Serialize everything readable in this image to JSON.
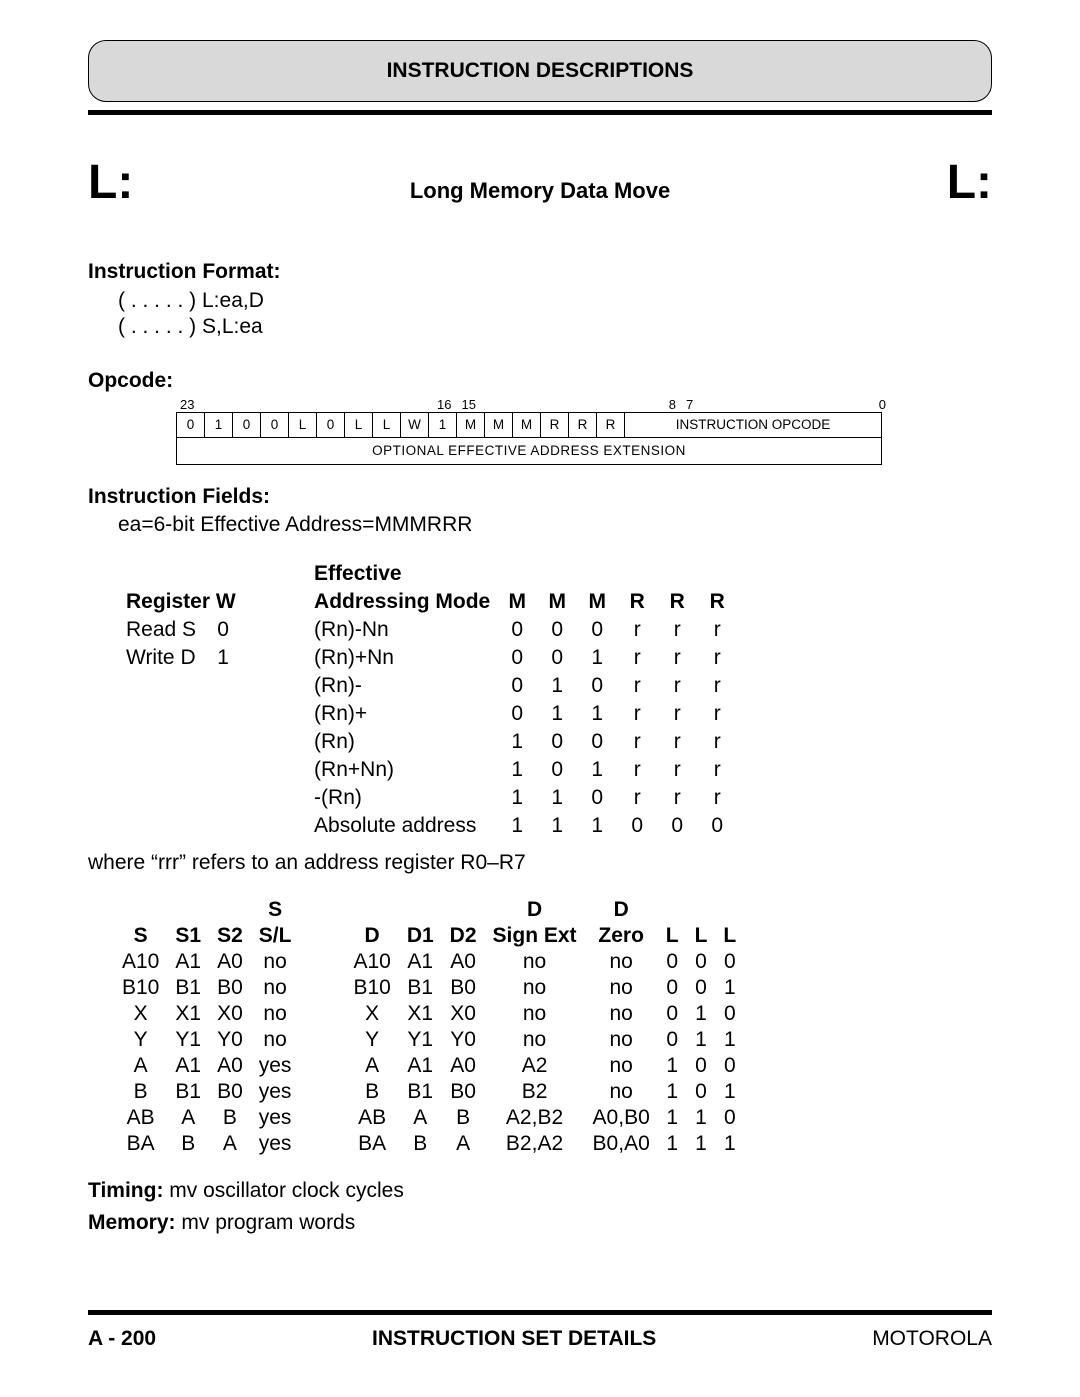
{
  "header": {
    "title": "INSTRUCTION DESCRIPTIONS"
  },
  "title": {
    "mnemonic_left": "L:",
    "name": "Long Memory Data Move",
    "mnemonic_right": "L:"
  },
  "format": {
    "heading": "Instruction Format:",
    "line1": "( . . . . . ) L:ea,D",
    "line2": "( . . . . . ) S,L:ea"
  },
  "opcode": {
    "heading": "Opcode:",
    "bitnums": [
      "23",
      "16",
      "15",
      "8",
      "7",
      "0"
    ],
    "row1": [
      "0",
      "1",
      "0",
      "0",
      "L",
      "0",
      "L",
      "L",
      "W",
      "1",
      "M",
      "M",
      "M",
      "R",
      "R",
      "R",
      "INSTRUCTION OPCODE"
    ],
    "row2": "OPTIONAL EFFECTIVE ADDRESS EXTENSION"
  },
  "fields": {
    "heading": "Instruction Fields:",
    "desc": "ea=6-bit Effective Address=MMMRRR",
    "header_registerW": "Register W",
    "header_effective1": "Effective",
    "header_effective2": "Addressing Mode",
    "header_MMMRRR": [
      "M",
      "M",
      "M",
      "R",
      "R",
      "R"
    ],
    "regW": [
      {
        "label": "Read S",
        "val": "0"
      },
      {
        "label": "Write D",
        "val": "1"
      }
    ],
    "ea_modes": [
      {
        "mode": "(Rn)-Nn",
        "bits": [
          "0",
          "0",
          "0",
          "r",
          "r",
          "r"
        ]
      },
      {
        "mode": "(Rn)+Nn",
        "bits": [
          "0",
          "0",
          "1",
          "r",
          "r",
          "r"
        ]
      },
      {
        "mode": "(Rn)-",
        "bits": [
          "0",
          "1",
          "0",
          "r",
          "r",
          "r"
        ]
      },
      {
        "mode": "(Rn)+",
        "bits": [
          "0",
          "1",
          "1",
          "r",
          "r",
          "r"
        ]
      },
      {
        "mode": "(Rn)",
        "bits": [
          "1",
          "0",
          "0",
          "r",
          "r",
          "r"
        ]
      },
      {
        "mode": "(Rn+Nn)",
        "bits": [
          "1",
          "0",
          "1",
          "r",
          "r",
          "r"
        ]
      },
      {
        "mode": "-(Rn)",
        "bits": [
          "1",
          "1",
          "0",
          "r",
          "r",
          "r"
        ]
      },
      {
        "mode": "Absolute address",
        "bits": [
          "1",
          "1",
          "1",
          "0",
          "0",
          "0"
        ]
      }
    ],
    "note": "where “rrr” refers to an address register R0–R7"
  },
  "regtable": {
    "headers_top": [
      "",
      "",
      "",
      "S",
      "",
      "",
      "",
      "",
      "D",
      "D",
      "",
      "",
      ""
    ],
    "headers": [
      "S",
      "S1",
      "S2",
      "S/L",
      "",
      "D",
      "D1",
      "D2",
      "Sign Ext",
      "Zero",
      "L",
      "L",
      "L"
    ],
    "rows": [
      [
        "A10",
        "A1",
        "A0",
        "no",
        "",
        "A10",
        "A1",
        "A0",
        "no",
        "no",
        "0",
        "0",
        "0"
      ],
      [
        "B10",
        "B1",
        "B0",
        "no",
        "",
        "B10",
        "B1",
        "B0",
        "no",
        "no",
        "0",
        "0",
        "1"
      ],
      [
        "X",
        "X1",
        "X0",
        "no",
        "",
        "X",
        "X1",
        "X0",
        "no",
        "no",
        "0",
        "1",
        "0"
      ],
      [
        "Y",
        "Y1",
        "Y0",
        "no",
        "",
        "Y",
        "Y1",
        "Y0",
        "no",
        "no",
        "0",
        "1",
        "1"
      ],
      [
        "A",
        "A1",
        "A0",
        "yes",
        "",
        "A",
        "A1",
        "A0",
        "A2",
        "no",
        "1",
        "0",
        "0"
      ],
      [
        "B",
        "B1",
        "B0",
        "yes",
        "",
        "B",
        "B1",
        "B0",
        "B2",
        "no",
        "1",
        "0",
        "1"
      ],
      [
        "AB",
        "A",
        "B",
        "yes",
        "",
        "AB",
        "A",
        "B",
        "A2,B2",
        "A0,B0",
        "1",
        "1",
        "0"
      ],
      [
        "BA",
        "B",
        "A",
        "yes",
        "",
        "BA",
        "B",
        "A",
        "B2,A2",
        "B0,A0",
        "1",
        "1",
        "1"
      ]
    ]
  },
  "timing": {
    "label": "Timing:",
    "text": " mv oscillator clock cycles"
  },
  "memory": {
    "label": "Memory:",
    "text": " mv program words"
  },
  "footer": {
    "page": "A - 200",
    "section": "INSTRUCTION SET DETAILS",
    "vendor": "MOTOROLA"
  }
}
